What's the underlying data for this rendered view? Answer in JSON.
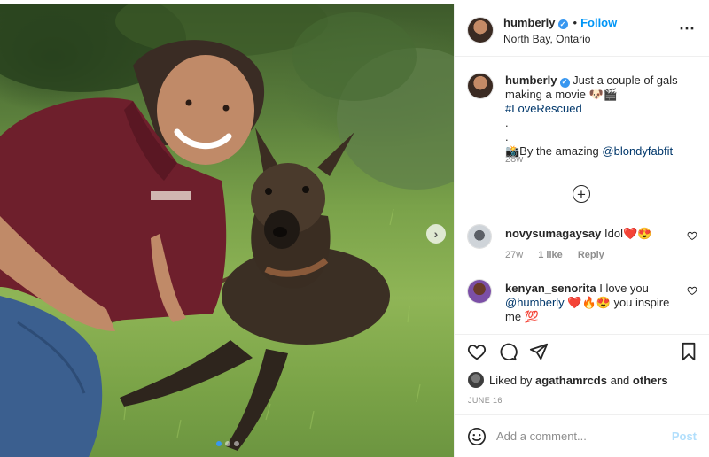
{
  "post": {
    "username": "humberly",
    "verified": true,
    "follow_label": "Follow",
    "separator": "•",
    "location": "North Bay, Ontario",
    "more_icon": "more-horizontal-icon"
  },
  "caption": {
    "username": "humberly",
    "line1_text": "Just a couple of gals making a movie 🐶🎬 ",
    "hashtag": "#LoveRescued",
    "dot1": ".",
    "dot2": ".",
    "credit_text": "📸By the amazing ",
    "credit_mention": "@blondyfabfit",
    "time": "28w"
  },
  "load_more_icon": "plus-circle-icon",
  "comments": [
    {
      "username": "novysumagaysay",
      "text": "Idol❤️😍",
      "time": "27w",
      "likes": "1 like",
      "reply_label": "Reply"
    },
    {
      "username": "kenyan_senorita",
      "text_before": "I love you ",
      "mention": "@humberly",
      "text_after": " ❤️🔥😍 you inspire me 💯"
    }
  ],
  "actions": {
    "like_icon": "heart-icon",
    "comment_icon": "comment-icon",
    "share_icon": "paper-plane-icon",
    "save_icon": "bookmark-icon"
  },
  "likes": {
    "prefix": "Liked by ",
    "user": "agathamrcds",
    "middle": " and ",
    "others": "others"
  },
  "date": "JUNE 16",
  "add_comment": {
    "placeholder": "Add a comment...",
    "post_label": "Post"
  },
  "carousel": {
    "next_label": "›",
    "slide_count": 3,
    "active_index": 0
  },
  "colors": {
    "link": "#00376b",
    "follow": "#0095f6",
    "verified": "#3897f0",
    "post_disabled": "#b2dffc",
    "heart": "#ed4956"
  }
}
